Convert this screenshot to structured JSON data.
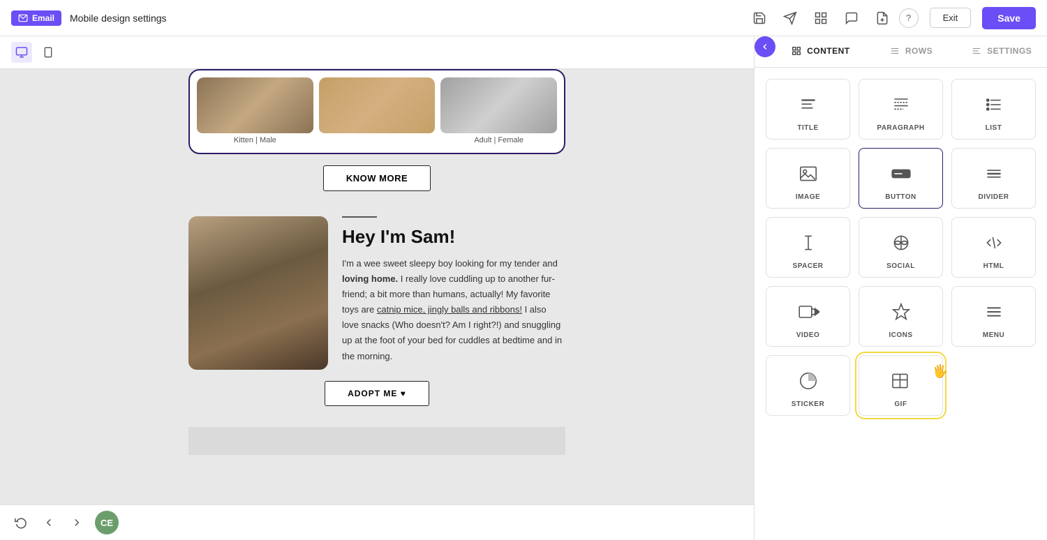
{
  "topbar": {
    "email_badge": "Email",
    "title": "Mobile design settings",
    "exit_label": "Exit",
    "save_label": "Save",
    "help_label": "?"
  },
  "device_toolbar": {
    "desktop_label": "desktop",
    "mobile_label": "mobile"
  },
  "email_content": {
    "cat1_label": "Kitten | Male",
    "cat2_label": "",
    "cat3_label": "Adult | Female",
    "know_more_btn": "KNOW MORE",
    "sam_divider": "",
    "sam_title": "Hey I'm Sam!",
    "sam_text_1": "I'm a wee sweet sleepy boy looking for my tender and ",
    "sam_bold": "loving home.",
    "sam_text_2": " I really love cuddling up to another fur-friend; a bit more than humans, actually! My favorite toys are ",
    "sam_link": "catnip mice, jingly balls and ribbons!",
    "sam_text_3": " I also love snacks (Who doesn't? Am I right?!) and snuggling up at the foot of your bed for cuddles at bedtime and in the morning.",
    "adopt_btn": "ADOPT ME ♥"
  },
  "bottom_toolbar": {
    "undo_label": "undo",
    "back_label": "back",
    "forward_label": "forward",
    "avatar_text": "CE"
  },
  "right_panel": {
    "tab_content": "CONTENT",
    "tab_rows": "ROWS",
    "tab_settings": "SETTINGS",
    "items": [
      {
        "id": "title",
        "label": "TITLE"
      },
      {
        "id": "paragraph",
        "label": "PARAGRAPH"
      },
      {
        "id": "list",
        "label": "LIST"
      },
      {
        "id": "image",
        "label": "IMAGE"
      },
      {
        "id": "button",
        "label": "BUTTON"
      },
      {
        "id": "divider",
        "label": "DIVIDER"
      },
      {
        "id": "spacer",
        "label": "SPACER"
      },
      {
        "id": "social",
        "label": "SOCIAL"
      },
      {
        "id": "html",
        "label": "HTML"
      },
      {
        "id": "video",
        "label": "VIDEO"
      },
      {
        "id": "icons",
        "label": "ICONS"
      },
      {
        "id": "menu",
        "label": "MENU"
      },
      {
        "id": "sticker",
        "label": "STICKER"
      },
      {
        "id": "gif",
        "label": "GIF"
      }
    ]
  }
}
